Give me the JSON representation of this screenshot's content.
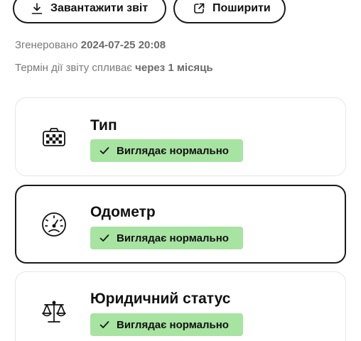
{
  "actions": {
    "download_label": "Завантажити звіт",
    "share_label": "Поширити"
  },
  "meta": {
    "generated_label": "Згенеровано",
    "generated_value": "2024-07-25 20:08",
    "expiry_label": "Термін дії звіту спливає",
    "expiry_value": "через 1 місяць"
  },
  "checks": [
    {
      "title": "Тип",
      "status": "Виглядає нормально",
      "icon": "taxi-sign-icon",
      "selected": false
    },
    {
      "title": "Одометр",
      "status": "Виглядає нормально",
      "icon": "odometer-gauge-icon",
      "selected": true
    },
    {
      "title": "Юридичний статус",
      "status": "Виглядає нормально",
      "icon": "scales-icon",
      "selected": false
    }
  ],
  "colors": {
    "badge_ok": "#a7e3a1",
    "border_selected": "#1a1a1a",
    "border_default": "#e6e6e6",
    "muted_text": "#7a7a7a"
  }
}
